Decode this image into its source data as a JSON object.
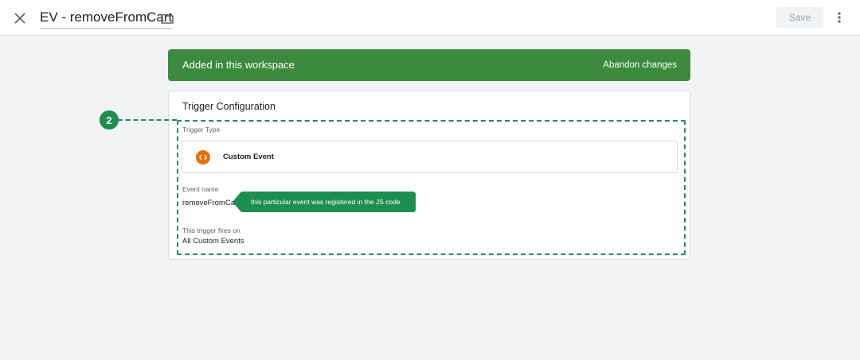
{
  "header": {
    "title": "EV - removeFromCart",
    "save_label": "Save"
  },
  "banner": {
    "text": "Added in this workspace",
    "action_label": "Abandon changes"
  },
  "card": {
    "title": "Trigger Configuration",
    "trigger_type_label": "Trigger Type",
    "trigger_type_value": "Custom Event",
    "event_name_label": "Event name",
    "event_name_value": "removeFromCart",
    "fires_on_label": "This trigger fires on",
    "fires_on_value": "All Custom Events"
  },
  "annotation": {
    "step_number": "2",
    "tooltip": "this particular event was registered in the JS code",
    "color": "#1e8e4f"
  },
  "icons": {
    "close": "close-icon",
    "folder": "folder-icon",
    "more": "more-vert-icon",
    "custom_event": "code-icon"
  },
  "colors": {
    "banner_bg": "#3b8a3e",
    "custom_event_icon": "#e8710a"
  }
}
